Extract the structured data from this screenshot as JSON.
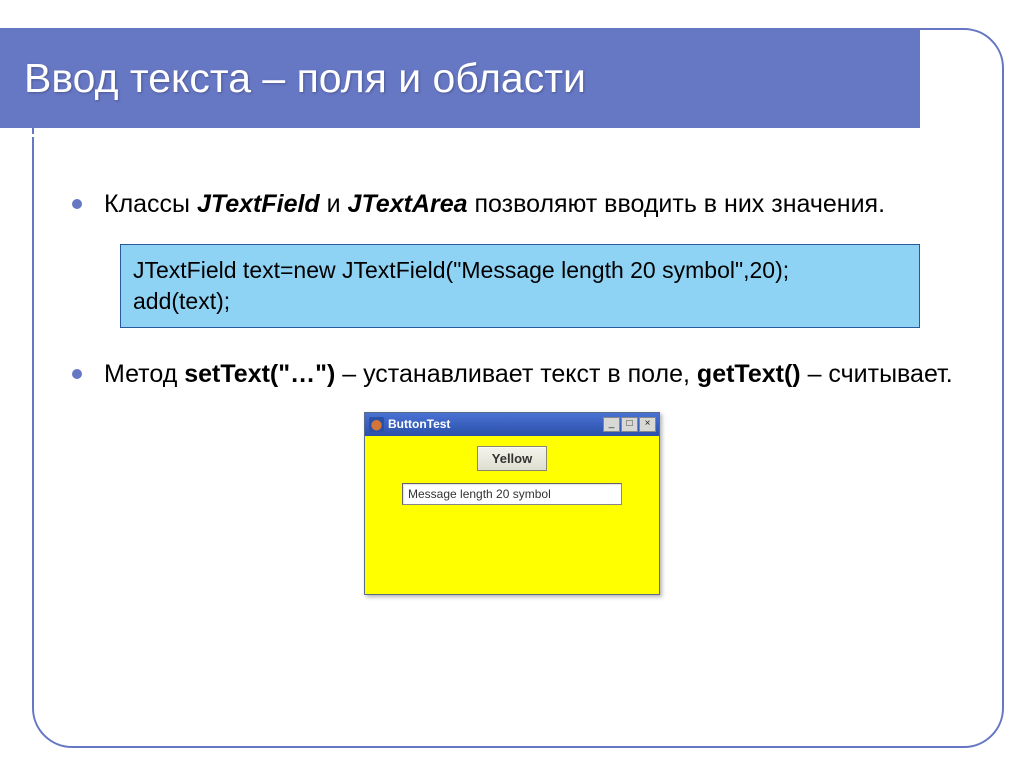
{
  "slide": {
    "title": "Ввод текста – поля и области"
  },
  "bullets": {
    "b1_pre": "Классы ",
    "b1_j1": "JTextField",
    "b1_and": " и ",
    "b1_j2": "JTextArea",
    "b1_post": " позволяют вводить в них значения.",
    "b2_pre": "Метод ",
    "b2_m1": "setText(\"…\")",
    "b2_mid": " – устанавливает текст в поле, ",
    "b2_m2": "getText()",
    "b2_post": " – считывает."
  },
  "code": {
    "line1": "JTextField text=new JTextField(\"Message length 20 symbol\",20);",
    "line2": "add(text);"
  },
  "demo": {
    "window_title": "ButtonTest",
    "button_label": "Yellow",
    "textfield_value": "Message length 20 symbol",
    "controls": {
      "minimize": "_",
      "maximize": "□",
      "close": "×"
    }
  }
}
